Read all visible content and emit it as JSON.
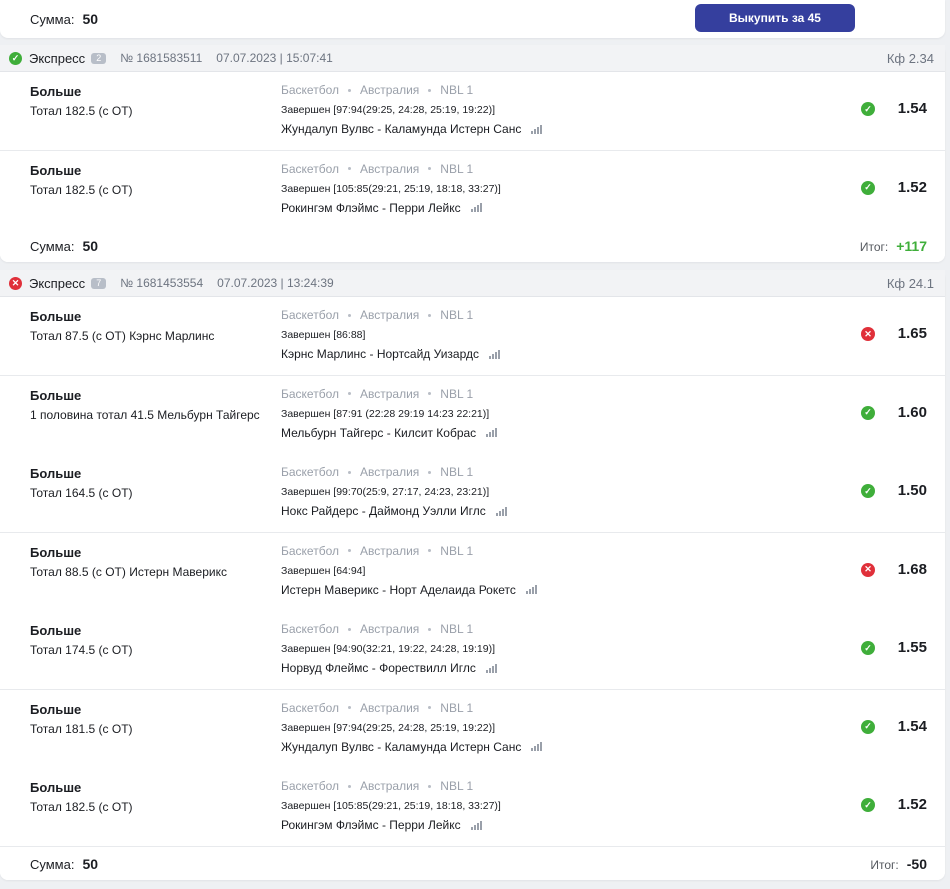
{
  "top": {
    "sum_label": "Сумма:",
    "sum_value": "50",
    "buy_button": "Выкупить за 45"
  },
  "bets": [
    {
      "title": "Экспресс",
      "count": "2",
      "number": "№ 1681583511",
      "date": "07.07.2023 | 15:07:41",
      "kf": "Кф 2.34",
      "status": "win",
      "sum_label": "Сумма:",
      "sum_value": "50",
      "itog_label": "Итог:",
      "itog_value": "+117",
      "events": [
        {
          "type": "Больше",
          "desc": "Тотал 182.5 (с ОТ)",
          "sport": "Баскетбол",
          "country": "Австралия",
          "league": "NBL 1",
          "result": "Завершен [97:94(29:25, 24:28, 25:19, 19:22)]",
          "match": "Жундалуп Вулвс - Каламунда Истерн Санс",
          "outcome": "win",
          "odd": "1.54"
        },
        {
          "type": "Больше",
          "desc": "Тотал 182.5 (с ОТ)",
          "sport": "Баскетбол",
          "country": "Австралия",
          "league": "NBL 1",
          "result": "Завершен [105:85(29:21, 25:19, 18:18, 33:27)]",
          "match": "Рокингэм Флэймс - Перри Лейкс",
          "outcome": "win",
          "odd": "1.52"
        }
      ]
    },
    {
      "title": "Экспресс",
      "count": "7",
      "number": "№ 1681453554",
      "date": "07.07.2023 | 13:24:39",
      "kf": "Кф 24.1",
      "status": "loss",
      "sum_label": "Сумма:",
      "sum_value": "50",
      "itog_label": "Итог:",
      "itog_value": "-50",
      "events": [
        {
          "type": "Больше",
          "desc": "Тотал 87.5 (с ОТ) Кэрнс Марлинс",
          "sport": "Баскетбол",
          "country": "Австралия",
          "league": "NBL 1",
          "result": "Завершен [86:88]",
          "match": "Кэрнс Марлинс - Нортсайд Уизардс",
          "outcome": "loss",
          "odd": "1.65"
        },
        {
          "type": "Больше",
          "desc": "1 половина тотал 41.5 Мельбурн Тайгерс",
          "sport": "Баскетбол",
          "country": "Австралия",
          "league": "NBL 1",
          "result": "Завершен [87:91 (22:28 29:19 14:23 22:21)]",
          "match": "Мельбурн Тайгерс - Килсит Кобрас",
          "outcome": "win",
          "odd": "1.60"
        },
        {
          "type": "Больше",
          "desc": "Тотал 164.5 (с ОТ)",
          "sport": "Баскетбол",
          "country": "Австралия",
          "league": "NBL 1",
          "result": "Завершен [99:70(25:9, 27:17, 24:23, 23:21)]",
          "match": "Нокс Райдерс - Даймонд Уэлли Иглс",
          "outcome": "win",
          "odd": "1.50"
        },
        {
          "type": "Больше",
          "desc": "Тотал 88.5 (с ОТ) Истерн Маверикс",
          "sport": "Баскетбол",
          "country": "Австралия",
          "league": "NBL 1",
          "result": "Завершен [64:94]",
          "match": "Истерн Маверикс - Норт Аделаида Рокетс",
          "outcome": "loss",
          "odd": "1.68"
        },
        {
          "type": "Больше",
          "desc": "Тотал 174.5 (с ОТ)",
          "sport": "Баскетбол",
          "country": "Австралия",
          "league": "NBL 1",
          "result": "Завершен [94:90(32:21, 19:22, 24:28, 19:19)]",
          "match": "Норвуд Флеймс - Форествилл Иглс",
          "outcome": "win",
          "odd": "1.55"
        },
        {
          "type": "Больше",
          "desc": "Тотал 181.5 (с ОТ)",
          "sport": "Баскетбол",
          "country": "Австралия",
          "league": "NBL 1",
          "result": "Завершен [97:94(29:25, 24:28, 25:19, 19:22)]",
          "match": "Жундалуп Вулвс - Каламунда Истерн Санс",
          "outcome": "win",
          "odd": "1.54"
        },
        {
          "type": "Больше",
          "desc": "Тотал 182.5 (с ОТ)",
          "sport": "Баскетбол",
          "country": "Австралия",
          "league": "NBL 1",
          "result": "Завершен [105:85(29:21, 25:19, 18:18, 33:27)]",
          "match": "Рокингэм Флэймс - Перри Лейкс",
          "outcome": "win",
          "odd": "1.52"
        }
      ]
    }
  ]
}
